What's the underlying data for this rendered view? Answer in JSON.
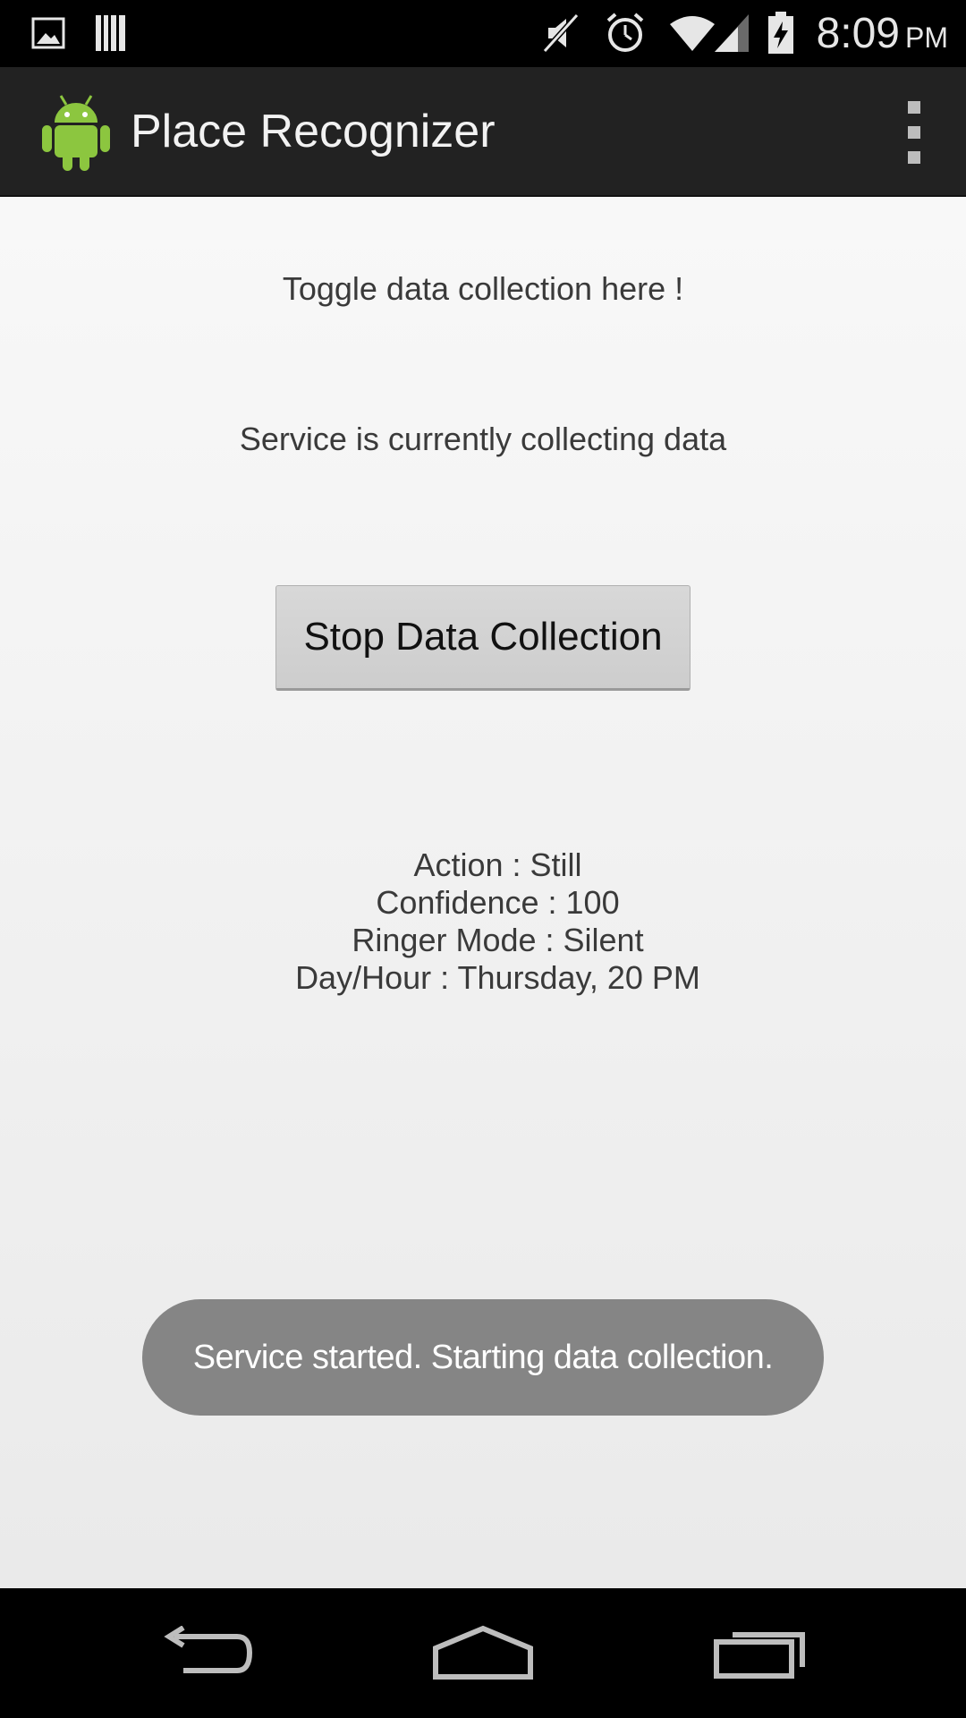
{
  "status_bar": {
    "icons": [
      "gallery-notification-icon",
      "barcode-notification-icon",
      "muted-icon",
      "alarm-icon",
      "wifi-icon",
      "cell-signal-icon",
      "battery-charging-icon"
    ],
    "time": "8:09",
    "ampm": "PM"
  },
  "action_bar": {
    "title": "Place Recognizer",
    "logo_icon": "android-robot-icon",
    "menu_icon": "overflow-menu-icon"
  },
  "main": {
    "toggle_label": "Toggle data collection here !",
    "service_status": "Service is currently collecting data",
    "stop_button_label": "Stop Data Collection",
    "info": {
      "action": "Action : Still",
      "confidence": "Confidence : 100",
      "ringer_mode": "Ringer Mode : Silent",
      "day_hour": "Day/Hour : Thursday, 20 PM"
    }
  },
  "toast": {
    "message": "Service started. Starting data collection."
  },
  "nav_bar": {
    "buttons": [
      "back-icon",
      "home-icon",
      "recent-apps-icon"
    ]
  },
  "colors": {
    "accent_android_green": "#8cc63f",
    "action_bar": "#222222",
    "toast_background": "#858585"
  }
}
